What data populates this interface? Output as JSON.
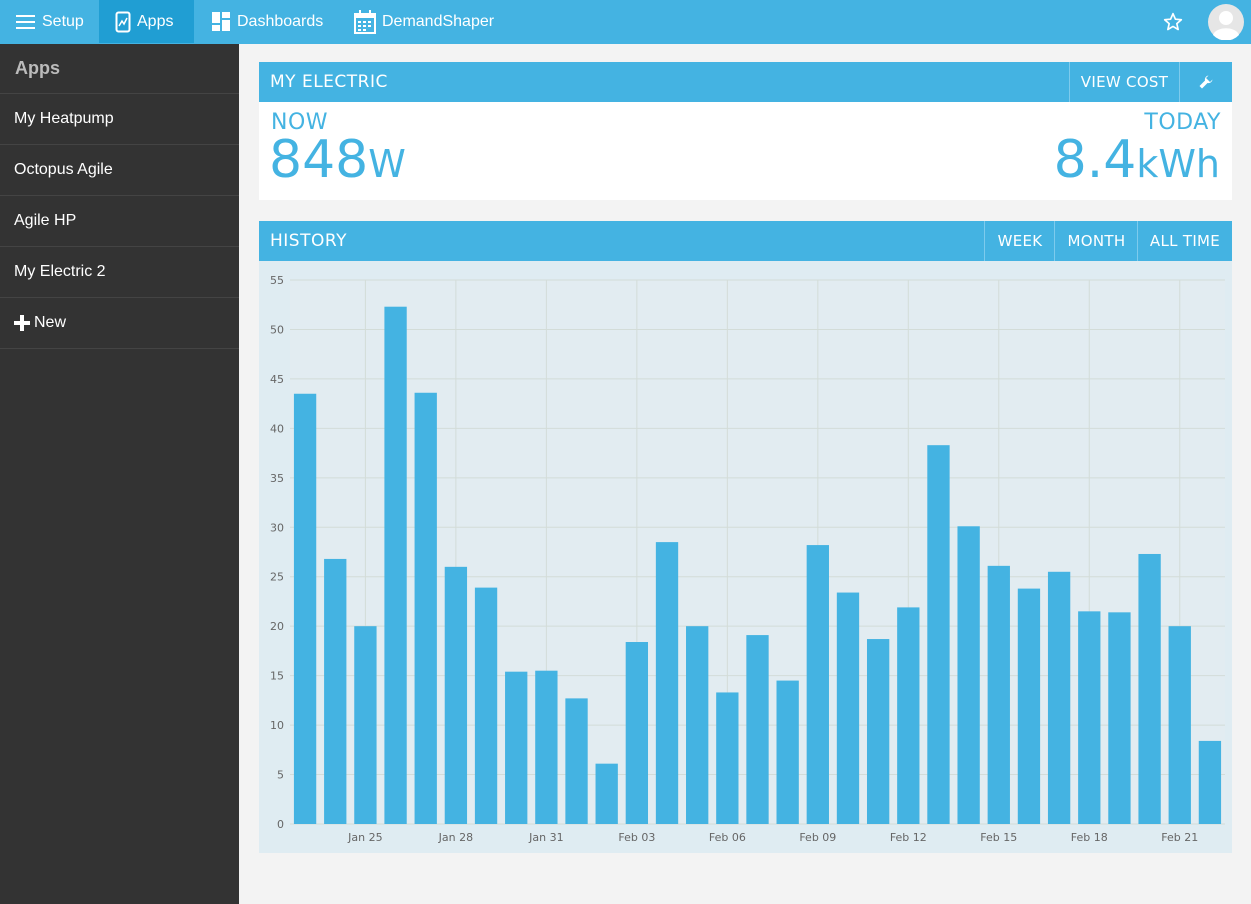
{
  "topbar": {
    "setup_label": "Setup",
    "apps_label": "Apps",
    "dashboards_label": "Dashboards",
    "demandshaper_label": "DemandShaper",
    "icons": [
      "menu-icon",
      "apps-icon",
      "dashboards-icon",
      "calendar-icon",
      "star-icon",
      "user-avatar-icon"
    ]
  },
  "sidebar": {
    "title": "Apps",
    "items": [
      {
        "label": "My Heatpump"
      },
      {
        "label": "Octopus Agile"
      },
      {
        "label": "Agile HP"
      },
      {
        "label": "My Electric 2"
      },
      {
        "label": "New"
      }
    ]
  },
  "panel": {
    "title": "MY ELECTRIC",
    "view_cost_label": "VIEW COST",
    "now_label": "NOW",
    "now_value": "848",
    "now_unit": "W",
    "today_label": "TODAY",
    "today_value": "8.4",
    "today_unit": "kWh"
  },
  "history": {
    "title": "HISTORY",
    "week_label": "WEEK",
    "month_label": "MONTH",
    "alltime_label": "ALL TIME"
  },
  "colors": {
    "accent": "#44b3e2",
    "active_nav": "#209ed3",
    "sidebar_bg": "#333333",
    "chart_bg": "#dfecf2",
    "bar": "#44b3e2"
  },
  "chart_data": {
    "type": "bar",
    "x": [
      "Jan 23",
      "Jan 24",
      "Jan 25",
      "Jan 26",
      "Jan 27",
      "Jan 28",
      "Jan 29",
      "Jan 30",
      "Jan 31",
      "Feb 01",
      "Feb 02",
      "Feb 03",
      "Feb 04",
      "Feb 05",
      "Feb 06",
      "Feb 07",
      "Feb 08",
      "Feb 09",
      "Feb 10",
      "Feb 11",
      "Feb 12",
      "Feb 13",
      "Feb 14",
      "Feb 15",
      "Feb 16",
      "Feb 17",
      "Feb 18",
      "Feb 19",
      "Feb 20",
      "Feb 21",
      "Feb 22"
    ],
    "values": [
      43.5,
      26.8,
      20.0,
      52.3,
      43.6,
      26.0,
      23.9,
      15.4,
      15.5,
      12.7,
      6.1,
      18.4,
      28.5,
      20.0,
      13.3,
      19.1,
      14.5,
      28.2,
      23.4,
      18.7,
      21.9,
      38.3,
      30.1,
      26.1,
      23.8,
      25.5,
      21.5,
      21.4,
      27.3,
      20.0,
      8.4
    ],
    "tick_labels": [
      "Jan 25",
      "Jan 28",
      "Jan 31",
      "Feb 03",
      "Feb 06",
      "Feb 09",
      "Feb 12",
      "Feb 15",
      "Feb 18",
      "Feb 21"
    ],
    "tick_indices": [
      2,
      5,
      8,
      11,
      14,
      17,
      20,
      23,
      26,
      29
    ],
    "y_ticks": [
      0,
      5,
      10,
      15,
      20,
      25,
      30,
      35,
      40,
      45,
      50,
      55
    ],
    "ylim": [
      0,
      55
    ],
    "grid": true
  }
}
